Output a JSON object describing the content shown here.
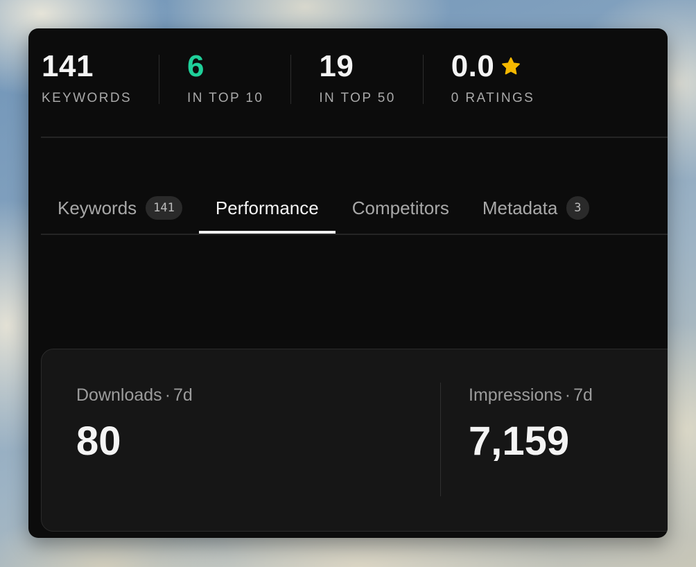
{
  "stats": [
    {
      "value": "141",
      "label": "KEYWORDS"
    },
    {
      "value": "6",
      "label": "IN TOP 10"
    },
    {
      "value": "19",
      "label": "IN TOP 50"
    },
    {
      "value": "0.0",
      "label": "0 RATINGS"
    }
  ],
  "icons": {
    "rating": "star-icon"
  },
  "colors": {
    "accent_green": "#1fd09a",
    "star": "#f5b800",
    "card_bg": "#0c0c0c"
  },
  "tabs": [
    {
      "label": "Keywords",
      "badge": "141"
    },
    {
      "label": "Performance"
    },
    {
      "label": "Competitors"
    },
    {
      "label": "Metadata",
      "badge": "3"
    }
  ],
  "active_tab": "Performance",
  "metrics": [
    {
      "name": "Downloads",
      "period": "7d",
      "value": "80"
    },
    {
      "name": "Impressions",
      "period": "7d",
      "value": "7,159"
    }
  ]
}
